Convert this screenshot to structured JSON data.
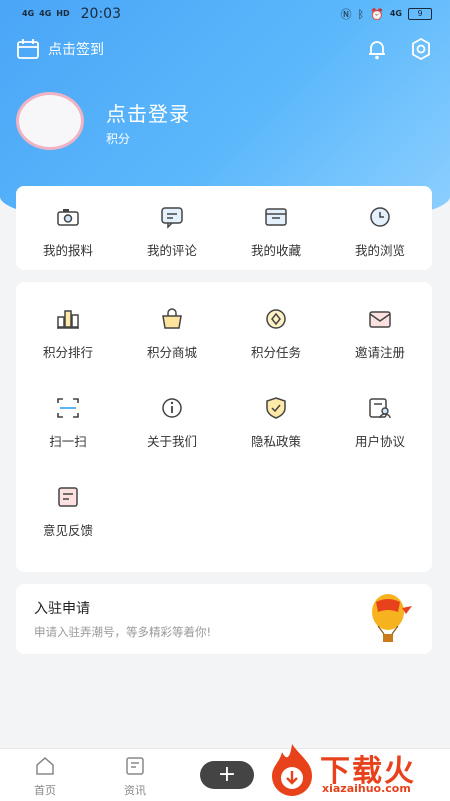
{
  "status_bar": {
    "time": "20:03",
    "left_signals": [
      "4G",
      "4G",
      "HD"
    ],
    "right_network": "4G",
    "battery": "9",
    "icons": [
      "nfc-icon",
      "bluetooth-icon",
      "alarm-icon",
      "network-icon",
      "battery-icon"
    ]
  },
  "header": {
    "checkin_label": "点击签到",
    "icons": [
      "bell-icon",
      "settings-icon"
    ]
  },
  "profile": {
    "login_label": "点击登录",
    "points_label": "积分"
  },
  "quick_menu": [
    {
      "label": "我的报料",
      "icon": "camera-icon"
    },
    {
      "label": "我的评论",
      "icon": "comment-icon"
    },
    {
      "label": "我的收藏",
      "icon": "favorites-box-icon"
    },
    {
      "label": "我的浏览",
      "icon": "clock-icon"
    }
  ],
  "services_menu": [
    {
      "label": "积分排行",
      "icon": "ranking-icon"
    },
    {
      "label": "积分商城",
      "icon": "shopping-bag-icon"
    },
    {
      "label": "积分任务",
      "icon": "coin-task-icon"
    },
    {
      "label": "邀请注册",
      "icon": "invite-envelope-icon"
    },
    {
      "label": "扫一扫",
      "icon": "scan-icon"
    },
    {
      "label": "关于我们",
      "icon": "info-icon"
    },
    {
      "label": "隐私政策",
      "icon": "shield-check-icon"
    },
    {
      "label": "用户协议",
      "icon": "user-agreement-icon"
    },
    {
      "label": "意见反馈",
      "icon": "feedback-icon"
    }
  ],
  "apply_card": {
    "title": "入驻申请",
    "subtitle": "申请入驻弄潮号，等多精彩等着你!",
    "icon": "hot-air-balloon-icon"
  },
  "tabbar": {
    "tabs": [
      {
        "label": "首页",
        "icon": "home-icon"
      },
      {
        "label": "资讯",
        "icon": "news-icon"
      }
    ],
    "plus_label": "+"
  },
  "watermark": {
    "brand": "下载火",
    "url": "xiazaihuo.com"
  },
  "colors": {
    "accent": "#4aa5f7",
    "watermark": "#e8421c"
  }
}
